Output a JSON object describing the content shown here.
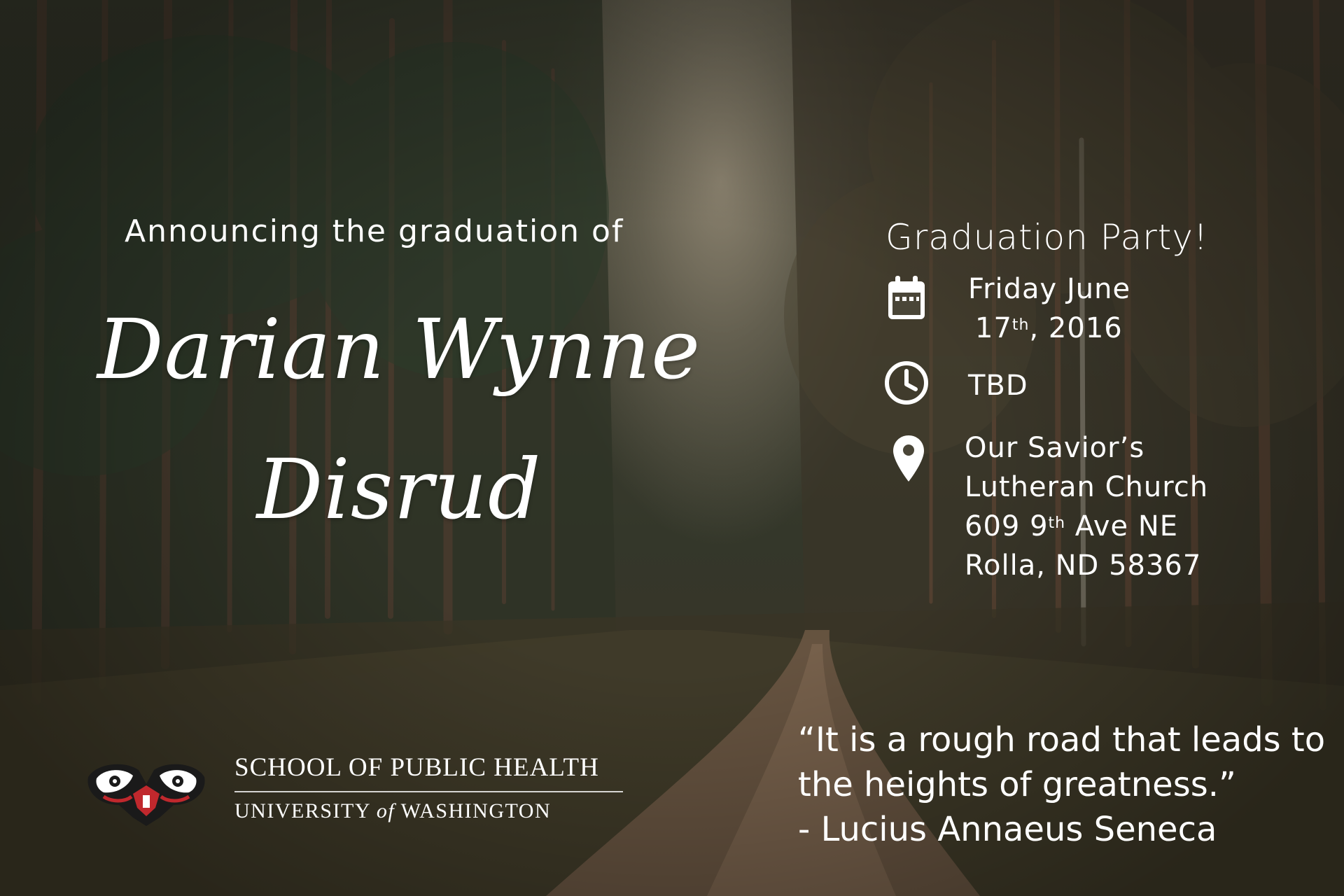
{
  "announcement": "Announcing the graduation of",
  "graduate": {
    "line1": "Darian Wynne",
    "line2": "Disrud"
  },
  "party": {
    "title": "Graduation Party!",
    "date_line1": "Friday June",
    "date_day": "17",
    "date_suffix": "th",
    "date_rest": ", 2016",
    "time": "TBD",
    "location_line1": "Our Savior’s",
    "location_line2": "Lutheran Church",
    "address_num": "609 9",
    "address_suffix": "th",
    "address_rest": " Ave NE",
    "city": "Rolla, ND 58367"
  },
  "icons": {
    "date": "calendar-icon",
    "time": "clock-icon",
    "location": "map-pin-icon"
  },
  "logo": {
    "line1": "SCHOOL OF PUBLIC HEALTH",
    "line2_a": "UNIVERSITY ",
    "line2_b": "of",
    "line2_c": " WASHINGTON"
  },
  "quote": {
    "line1": "“It is a rough road that leads to",
    "line2": "the heights of greatness.”",
    "author": "- Lucius Annaeus Seneca"
  },
  "colors": {
    "text": "#ffffff",
    "logo_red": "#c0282d",
    "logo_black": "#1a1a1a"
  }
}
